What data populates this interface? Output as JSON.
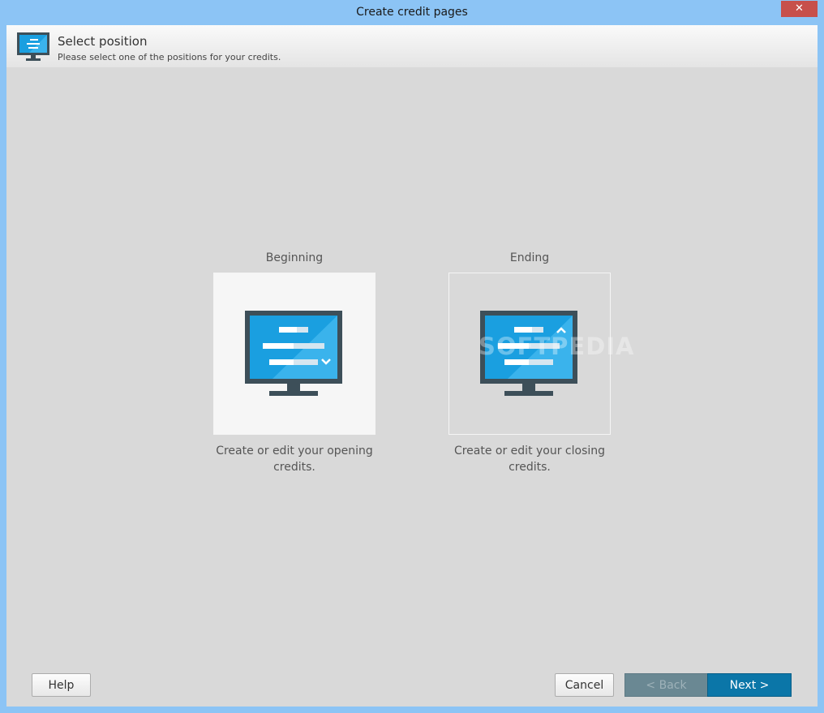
{
  "window": {
    "title": "Create credit pages",
    "close_glyph": "✕"
  },
  "header": {
    "title": "Select position",
    "subtitle": "Please select one of the positions for your credits.",
    "icon": "monitor-icon"
  },
  "options": [
    {
      "label": "Beginning",
      "description": "Create or edit your opening credits.",
      "icon": "monitor-credits-down-icon",
      "selected": true
    },
    {
      "label": "Ending",
      "description": "Create or edit your closing credits.",
      "icon": "monitor-credits-up-icon",
      "selected": false
    }
  ],
  "buttons": {
    "help": "Help",
    "cancel": "Cancel",
    "back": "< Back",
    "next": "Next >"
  },
  "watermark": "SOFTPEDIA",
  "colors": {
    "titlebar": "#8cc4f5",
    "close": "#c7504b",
    "monitor_screen": "#1a9fe0",
    "next_button": "#0b76a8"
  }
}
